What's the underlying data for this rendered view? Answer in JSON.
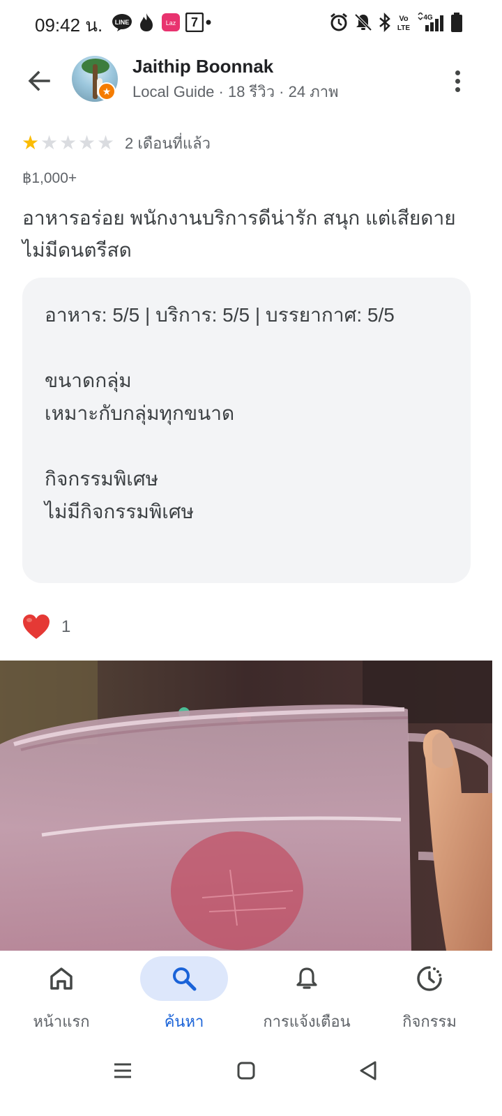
{
  "status_bar": {
    "time": "09:42 น.",
    "left_icons": [
      "line-icon",
      "flame-icon",
      "lazada-icon",
      "seven-eleven-icon",
      "dot-icon"
    ],
    "right_icons": [
      "alarm-icon",
      "bell-off-icon",
      "bluetooth-icon",
      "volte-icon",
      "signal-4g-icon",
      "battery-icon"
    ],
    "network_label": "4G",
    "volte_label": "Vo LTE"
  },
  "header": {
    "reviewer_name": "Jaithip Boonnak",
    "reviewer_meta": "Local Guide · 18 รีวิว · 24 ภาพ",
    "back_icon": "arrow-back-icon",
    "more_icon": "more-vert-icon"
  },
  "review": {
    "rating": 1,
    "max_rating": 5,
    "date": "2 เดือนที่แล้ว",
    "price": "฿1,000+",
    "text": "อาหารอร่อย พนักงานบริการดีน่ารัก สนุก แต่เสียดายไม่มีดนตรีสด",
    "details": {
      "ratings_line": "อาหาร: 5/5 | บริการ: 5/5 | บรรยากาศ: 5/5",
      "group_size_label": "ขนาดกลุ่ม",
      "group_size_value": "เหมาะกับกลุ่มทุกขนาด",
      "special_events_label": "กิจกรรมพิเศษ",
      "special_events_value": "ไม่มีกิจกรรมพิเศษ"
    },
    "reaction_count": "1",
    "reaction_color": "#e53935"
  },
  "bottom_nav": {
    "items": [
      {
        "label": "หน้าแรก",
        "icon": "home-icon",
        "active": false
      },
      {
        "label": "ค้นหา",
        "icon": "search-icon",
        "active": true
      },
      {
        "label": "การแจ้งเตือน",
        "icon": "bell-icon",
        "active": false
      },
      {
        "label": "กิจกรรม",
        "icon": "activity-clock-icon",
        "active": false
      }
    ],
    "active_color": "#1a63d8",
    "active_pill_color": "#dde7fb"
  },
  "system_nav": {
    "icons": [
      "menu-icon",
      "home-square-icon",
      "back-triangle-icon"
    ]
  }
}
